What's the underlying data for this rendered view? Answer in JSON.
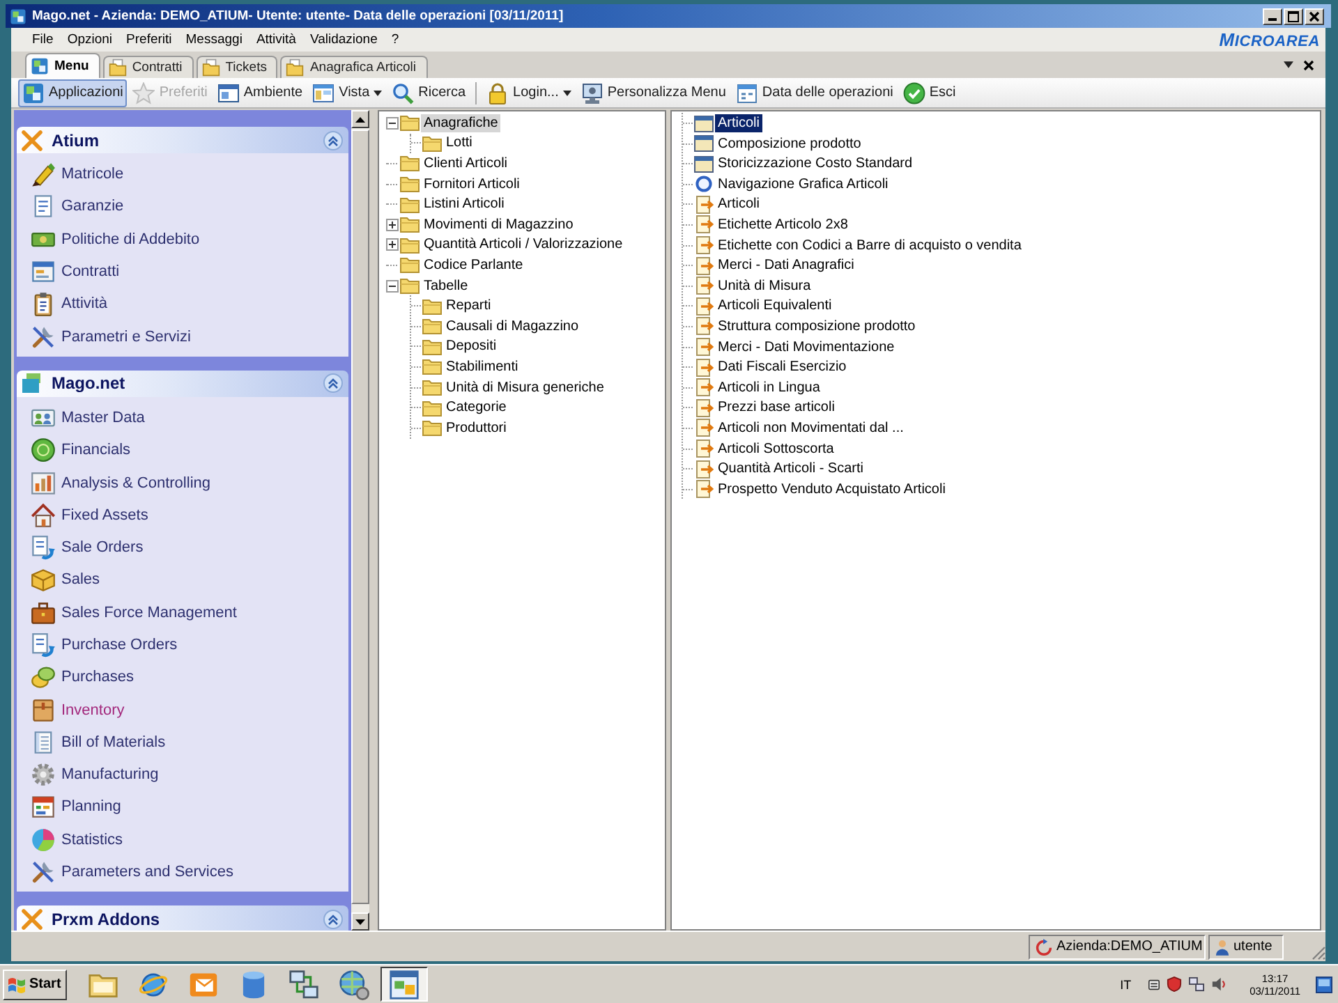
{
  "window": {
    "title": "Mago.net - Azienda: DEMO_ATIUM- Utente: utente- Data delle operazioni [03/11/2011]"
  },
  "menu_bar": {
    "items": [
      "File",
      "Opzioni",
      "Preferiti",
      "Messaggi",
      "Attività",
      "Validazione",
      "?"
    ],
    "logo": "MICROAREA"
  },
  "tabs": [
    {
      "label": "Menu",
      "selected": true
    },
    {
      "label": "Contratti",
      "selected": false
    },
    {
      "label": "Tickets",
      "selected": false
    },
    {
      "label": "Anagrafica Articoli",
      "selected": false
    }
  ],
  "toolbar": [
    {
      "label": "Applicazioni",
      "selected": true,
      "disabled": false,
      "dropdown": false,
      "divider_before": false
    },
    {
      "label": "Preferiti",
      "selected": false,
      "disabled": true,
      "dropdown": false,
      "divider_before": false
    },
    {
      "label": "Ambiente",
      "selected": false,
      "disabled": false,
      "dropdown": false,
      "divider_before": false
    },
    {
      "label": "Vista",
      "selected": false,
      "disabled": false,
      "dropdown": true,
      "divider_before": false
    },
    {
      "label": "Ricerca",
      "selected": false,
      "disabled": false,
      "dropdown": false,
      "divider_before": false
    },
    {
      "label": "Login...",
      "selected": false,
      "disabled": false,
      "dropdown": true,
      "divider_before": true
    },
    {
      "label": "Personalizza Menu",
      "selected": false,
      "disabled": false,
      "dropdown": false,
      "divider_before": false
    },
    {
      "label": "Data delle operazioni",
      "selected": false,
      "disabled": false,
      "dropdown": false,
      "divider_before": false
    },
    {
      "label": "Esci",
      "selected": false,
      "disabled": false,
      "dropdown": false,
      "divider_before": false
    }
  ],
  "sidebar": {
    "groups": [
      {
        "title": "Atium",
        "expanded": true,
        "items": [
          {
            "label": "Matricole",
            "selected": false
          },
          {
            "label": "Garanzie",
            "selected": false
          },
          {
            "label": "Politiche di Addebito",
            "selected": false
          },
          {
            "label": "Contratti",
            "selected": false
          },
          {
            "label": "Attività",
            "selected": false
          },
          {
            "label": "Parametri e Servizi",
            "selected": false
          }
        ]
      },
      {
        "title": "Mago.net",
        "expanded": true,
        "items": [
          {
            "label": "Master Data",
            "selected": false
          },
          {
            "label": "Financials",
            "selected": false
          },
          {
            "label": "Analysis & Controlling",
            "selected": false
          },
          {
            "label": "Fixed Assets",
            "selected": false
          },
          {
            "label": "Sale Orders",
            "selected": false
          },
          {
            "label": "Sales",
            "selected": false
          },
          {
            "label": "Sales Force Management",
            "selected": false
          },
          {
            "label": "Purchase Orders",
            "selected": false
          },
          {
            "label": "Purchases",
            "selected": false
          },
          {
            "label": "Inventory",
            "selected": true
          },
          {
            "label": "Bill of Materials",
            "selected": false
          },
          {
            "label": "Manufacturing",
            "selected": false
          },
          {
            "label": "Planning",
            "selected": false
          },
          {
            "label": "Statistics",
            "selected": false
          },
          {
            "label": "Parameters and Services",
            "selected": false
          }
        ]
      },
      {
        "title": "Prxm Addons",
        "expanded": true
      }
    ]
  },
  "tree": {
    "items": [
      {
        "label": "Anagrafiche",
        "selected": true,
        "expandable": true,
        "expanded": true,
        "children": [
          {
            "label": "Lotti",
            "selected": false,
            "expandable": false,
            "expanded": false
          }
        ]
      },
      {
        "label": "Clienti Articoli",
        "selected": false,
        "expandable": false,
        "expanded": false
      },
      {
        "label": "Fornitori Articoli",
        "selected": false,
        "expandable": false,
        "expanded": false
      },
      {
        "label": "Listini Articoli",
        "selected": false,
        "expandable": false,
        "expanded": false
      },
      {
        "label": "Movimenti di Magazzino",
        "selected": false,
        "expandable": true,
        "expanded": false
      },
      {
        "label": "Quantità Articoli / Valorizzazione",
        "selected": false,
        "expandable": true,
        "expanded": false
      },
      {
        "label": "Codice Parlante",
        "selected": false,
        "expandable": false,
        "expanded": false
      },
      {
        "label": "Tabelle",
        "selected": false,
        "expandable": true,
        "expanded": true,
        "children": [
          {
            "label": "Reparti",
            "selected": false,
            "expandable": false,
            "expanded": false
          },
          {
            "label": "Causali di Magazzino",
            "selected": false,
            "expandable": false,
            "expanded": false
          },
          {
            "label": "Depositi",
            "selected": false,
            "expandable": false,
            "expanded": false
          },
          {
            "label": "Stabilimenti",
            "selected": false,
            "expandable": false,
            "expanded": false
          },
          {
            "label": "Unità di Misura generiche",
            "selected": false,
            "expandable": false,
            "expanded": false
          },
          {
            "label": "Categorie",
            "selected": false,
            "expandable": false,
            "expanded": false
          },
          {
            "label": "Produttori",
            "selected": false,
            "expandable": false,
            "expanded": false
          }
        ]
      }
    ]
  },
  "list": {
    "items": [
      {
        "label": "Articoli",
        "kind": "document",
        "selected": true
      },
      {
        "label": "Composizione prodotto",
        "kind": "document",
        "selected": false
      },
      {
        "label": "Storicizzazione Costo Standard",
        "kind": "document",
        "selected": false
      },
      {
        "label": "Navigazione Grafica Articoli",
        "kind": "navigation",
        "selected": false
      },
      {
        "label": "Articoli",
        "kind": "report",
        "selected": false
      },
      {
        "label": "Etichette Articolo 2x8",
        "kind": "report",
        "selected": false
      },
      {
        "label": "Etichette con Codici a Barre di acquisto o vendita",
        "kind": "report",
        "selected": false
      },
      {
        "label": "Merci - Dati Anagrafici",
        "kind": "report",
        "selected": false
      },
      {
        "label": "Unità di Misura",
        "kind": "report",
        "selected": false
      },
      {
        "label": "Articoli Equivalenti",
        "kind": "report",
        "selected": false
      },
      {
        "label": "Struttura composizione prodotto",
        "kind": "report",
        "selected": false
      },
      {
        "label": "Merci - Dati Movimentazione",
        "kind": "report",
        "selected": false
      },
      {
        "label": "Dati Fiscali Esercizio",
        "kind": "report",
        "selected": false
      },
      {
        "label": "Articoli in Lingua",
        "kind": "report",
        "selected": false
      },
      {
        "label": "Prezzi base articoli",
        "kind": "report",
        "selected": false
      },
      {
        "label": "Articoli non Movimentati dal ...",
        "kind": "report",
        "selected": false
      },
      {
        "label": "Articoli Sottoscorta",
        "kind": "report",
        "selected": false
      },
      {
        "label": "Quantità Articoli - Scarti",
        "kind": "report",
        "selected": false
      },
      {
        "label": "Prospetto Venduto Acquistato Articoli",
        "kind": "report",
        "selected": false
      }
    ]
  },
  "status_bar": {
    "company": "Azienda:DEMO_ATIUM",
    "user": "utente"
  },
  "taskbar": {
    "start": "Start",
    "apps": [
      {
        "selected": false
      },
      {
        "selected": false
      },
      {
        "selected": false
      },
      {
        "selected": false
      },
      {
        "selected": false
      },
      {
        "selected": false
      },
      {
        "selected": true
      }
    ],
    "language": "IT",
    "time": "13:17",
    "date": "03/11/2011"
  }
}
